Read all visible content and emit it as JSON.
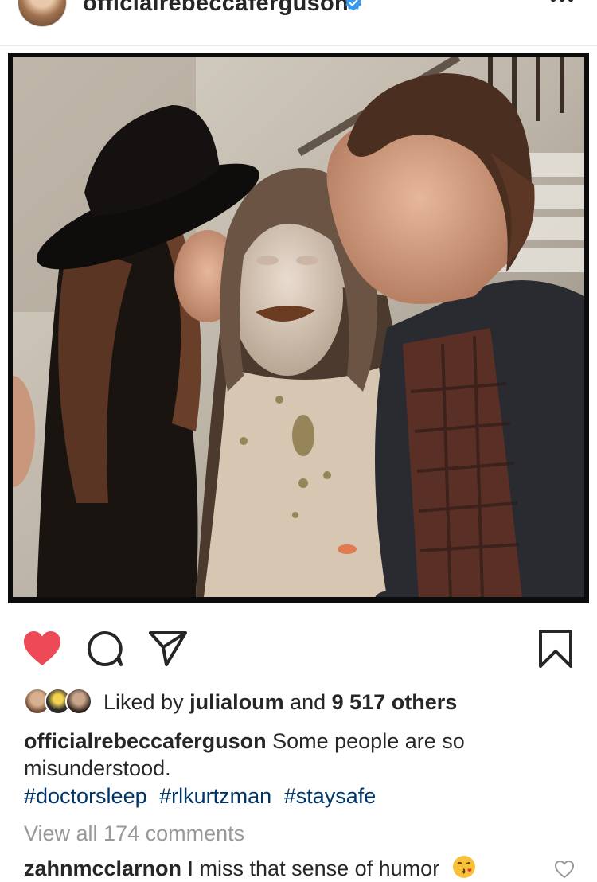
{
  "post": {
    "username": "officialrebeccaferguson",
    "verified_icon": "verified-badge-icon",
    "more_icon": "more-options-icon"
  },
  "actions": {
    "like_icon": "heart-filled-icon",
    "comment_icon": "comment-icon",
    "share_icon": "send-icon",
    "save_icon": "bookmark-icon",
    "like_color": "#ed4956"
  },
  "likes": {
    "prefix": "Liked by ",
    "user": "julialoum",
    "middle": " and ",
    "count": "9 517 others"
  },
  "caption": {
    "username": "officialrebeccaferguson",
    "text": " Some people are so misunderstood.",
    "hashtags": [
      "#doctorsleep",
      "#rlkurtzman",
      "#staysafe"
    ]
  },
  "view_all_comments": "View all 174 comments",
  "comment": {
    "username": "zahnmcclarnon",
    "text": " I miss that sense of humor",
    "emoji_icon": "kissing-face-emoji-icon"
  },
  "colors": {
    "text": "#262626",
    "hashtag": "#003569",
    "muted": "#999999"
  }
}
